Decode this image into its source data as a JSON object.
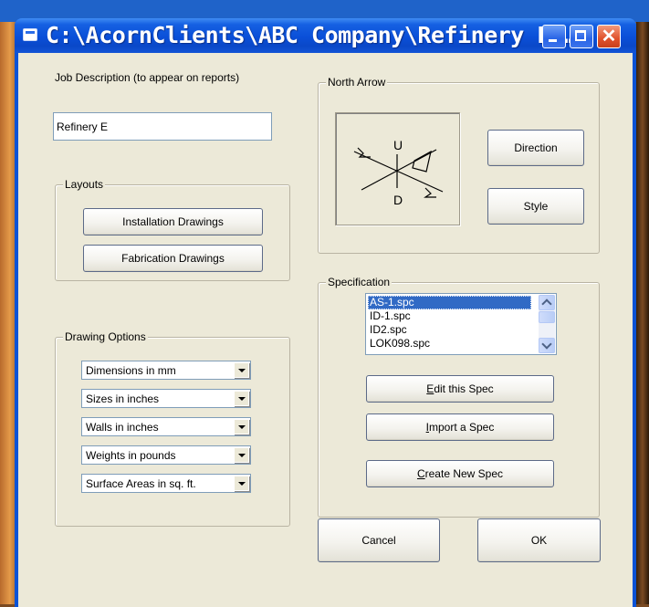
{
  "window": {
    "title": "C:\\AcornClients\\ABC Company\\Refinery E  …",
    "minimize_icon": "minimize-icon",
    "maximize_icon": "maximize-icon",
    "close_icon": "close-icon",
    "close_glyph": "✕"
  },
  "job": {
    "label": "Job Description (to appear on reports)",
    "value": "Refinery E"
  },
  "layouts": {
    "legend": "Layouts",
    "installation_button": "Installation Drawings",
    "fabrication_button": "Fabrication Drawings"
  },
  "drawing_options": {
    "legend": "Drawing Options",
    "combos": [
      {
        "value": "Dimensions in mm"
      },
      {
        "value": "Sizes in inches"
      },
      {
        "value": "Walls in inches"
      },
      {
        "value": "Weights in pounds"
      },
      {
        "value": "Surface Areas in sq. ft."
      }
    ]
  },
  "north_arrow": {
    "legend": "North Arrow",
    "direction_button": "Direction",
    "style_button": "Style",
    "labels": {
      "up": "U",
      "down": "D"
    },
    "icon": "north-arrow-symbol"
  },
  "specification": {
    "legend": "Specification",
    "items": [
      "AS-1.spc",
      "ID-1.spc",
      "ID2.spc",
      "LOK098.spc"
    ],
    "selected_index": 0,
    "edit_button_accel": "E",
    "edit_button_rest": "dit this Spec",
    "import_button_accel": "I",
    "import_button_rest": "mport a Spec",
    "create_button_accel": "C",
    "create_button_rest": "reate New Spec"
  },
  "footer": {
    "cancel_button": "Cancel",
    "ok_button": "OK"
  },
  "colors": {
    "titlebar": "#0a4fd8",
    "dialog_bg": "#ece9d8",
    "selection": "#316ac5"
  }
}
